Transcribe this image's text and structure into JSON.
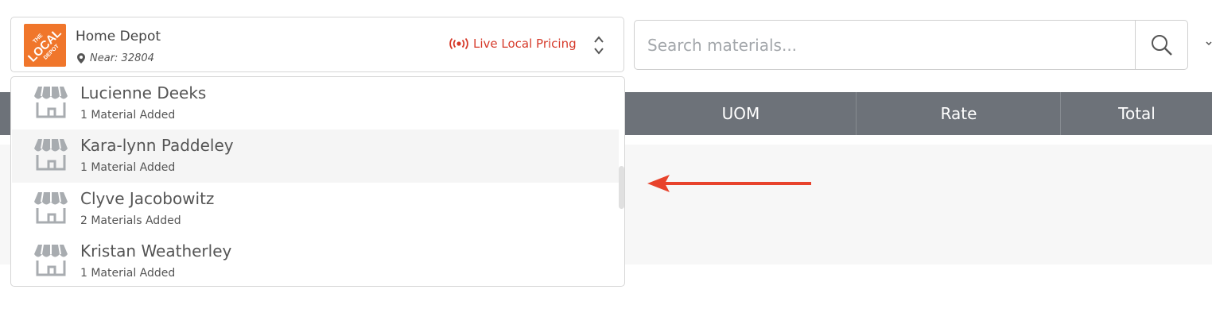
{
  "store_selector": {
    "logo_text": [
      "THE",
      "LOCAL",
      "DEPOT"
    ],
    "store_name": "Home Depot",
    "near_label": "Near: 32804",
    "live_pricing_label": "Live Local Pricing",
    "icons": [
      "location-pin-icon",
      "broadcast-icon",
      "chevron-updown-icon"
    ]
  },
  "search": {
    "placeholder": "Search materials...",
    "button_icon": "search-icon"
  },
  "table": {
    "columns": [
      "UOM",
      "Rate",
      "Total"
    ]
  },
  "dropdown": {
    "items": [
      {
        "name": "Lucienne Deeks",
        "count": "1 Material Added",
        "highlighted": false
      },
      {
        "name": "Kara-lynn Paddeley",
        "count": "1 Material Added",
        "highlighted": true
      },
      {
        "name": "Clyve Jacobowitz",
        "count": "2 Materials Added",
        "highlighted": false
      },
      {
        "name": "Kristan Weatherley",
        "count": "1 Material Added",
        "highlighted": false
      }
    ],
    "item_icon": "storefront-icon"
  },
  "colors": {
    "brand_orange": "#f0762b",
    "live_red": "#d63a2a",
    "table_header": "#6d7279",
    "arrow_red": "#e8432c"
  }
}
